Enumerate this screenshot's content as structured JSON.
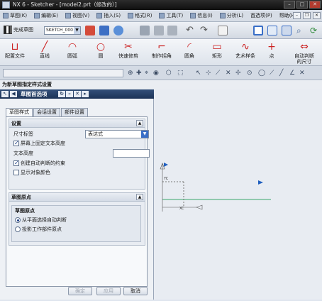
{
  "window": {
    "title": "NX 6 - Sketcher - [model2.prt（修改的）]"
  },
  "menu": [
    "草图(K)",
    "编辑(E)",
    "视图(V)",
    "插入(S)",
    "格式(R)",
    "工具(T)",
    "信息(I)",
    "分析(L)",
    "首选项(P)",
    "帮助(H)"
  ],
  "toolbar": {
    "finish_label": "完成草图",
    "sketch_name": "SKETCH_000"
  },
  "tools": [
    {
      "glyph": "⊔",
      "label": "配置文件"
    },
    {
      "glyph": "╱",
      "label": "直线"
    },
    {
      "glyph": "◠",
      "label": "圆弧"
    },
    {
      "glyph": "○",
      "label": "圆"
    },
    {
      "glyph": "✂",
      "label": "快速修剪"
    },
    {
      "glyph": "⌐",
      "label": "制作拐角"
    },
    {
      "glyph": "◜",
      "label": "圆角"
    },
    {
      "glyph": "▭",
      "label": "矩形"
    },
    {
      "glyph": "∿",
      "label": "艺术样条"
    },
    {
      "glyph": "+",
      "label": "点"
    },
    {
      "glyph": "⇔",
      "label": "自动判断的尺寸"
    }
  ],
  "command_prompt": "为新草图指定样式设置",
  "dialog": {
    "title": "草图首选项",
    "tabs": [
      "草图样式",
      "会话设置",
      "部件设置"
    ],
    "settings": {
      "header": "设置",
      "dim_label_text": "尺寸标签",
      "dim_label_value": "表达式",
      "fixed_text_height": "屏幕上固定文本高度",
      "fixed_text_height_checked": true,
      "text_height_label": "文本高度",
      "text_height_value": "",
      "create_inferred": "创建自动判断的约束",
      "create_inferred_checked": true,
      "show_object_color": "显示对象颜色",
      "show_object_color_checked": false
    },
    "origin": {
      "header": "草图原点",
      "group_label": "草图原点",
      "option1": "从平面选择自动判断",
      "option2": "投影工作部件原点",
      "selected": 1
    },
    "buttons": {
      "ok": "确定",
      "apply": "应用",
      "cancel": "取消"
    }
  },
  "canvas": {
    "axis_label": "YC",
    "xc_label": "XC"
  }
}
